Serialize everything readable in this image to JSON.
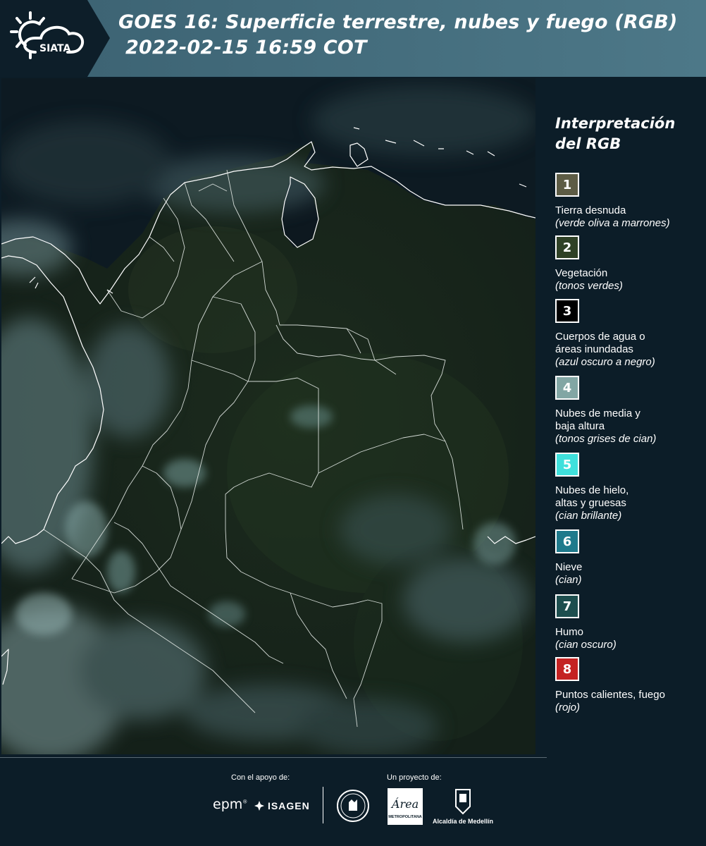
{
  "header": {
    "logo_text": "SIATA",
    "title_line1": "GOES 16: Superficie terrestre, nubes y fuego (RGB)",
    "title_line2": "2022-02-15 16:59 COT",
    "colors": {
      "band_left": "#0d1e29",
      "band_right": "#4c7584"
    }
  },
  "legend": {
    "title_line1": "Interpretación",
    "title_line2": "del RGB",
    "items": [
      {
        "number": "1",
        "color": "#5d5c45",
        "label": "Tierra desnuda",
        "sub": "(verde oliva a marrones)"
      },
      {
        "number": "2",
        "color": "#2f4126",
        "label": "Vegetación",
        "sub": "(tonos verdes)"
      },
      {
        "number": "3",
        "color": "#000000",
        "label": "Cuerpos de agua o áreas inundadas",
        "sub": "(azul oscuro a negro)"
      },
      {
        "number": "4",
        "color": "#82a6a4",
        "label": "Nubes de media y baja altura",
        "sub": "(tonos grises de cian)"
      },
      {
        "number": "5",
        "color": "#3fe0dc",
        "label": "Nubes de hielo, altas y gruesas",
        "sub": "(cian brillante)"
      },
      {
        "number": "6",
        "color": "#1f7a8c",
        "label": "Nieve",
        "sub": "(cian)"
      },
      {
        "number": "7",
        "color": "#1d4e4e",
        "label": "Humo",
        "sub": "(cian oscuro)"
      },
      {
        "number": "8",
        "color": "#c42222",
        "label": "Puntos calientes, fuego",
        "sub": "(rojo)"
      }
    ]
  },
  "footer": {
    "support_label": "Con el apoyo de:",
    "project_label": "Un proyecto de:",
    "epm": "epm",
    "isagen": "ISAGEN",
    "area": "Área",
    "area_sub": "METROPOLITANA",
    "medellin": "Alcaldía de Medellín"
  }
}
